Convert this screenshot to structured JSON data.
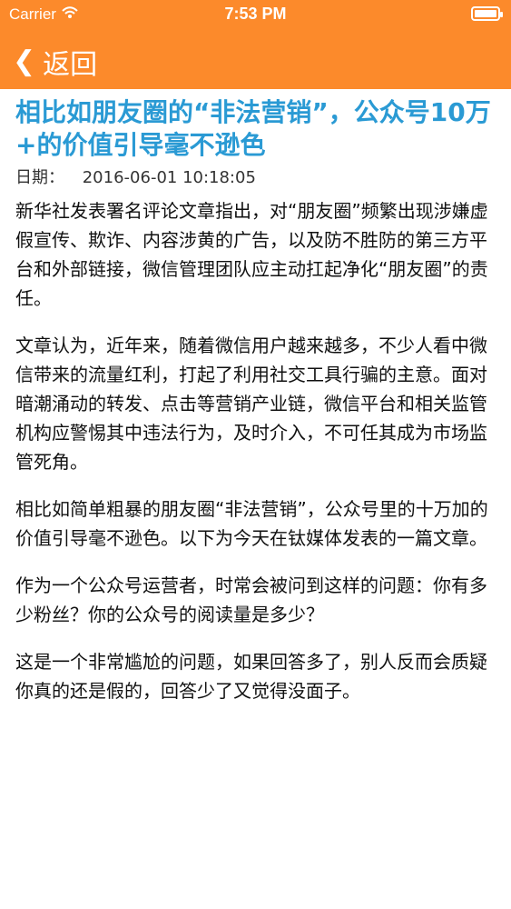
{
  "status_bar": {
    "carrier": "Carrier",
    "time": "7:53 PM",
    "wifi_icon": "wifi-icon",
    "battery_icon": "battery-icon"
  },
  "nav": {
    "back_icon": "chevron-left-icon",
    "back_label": "返回"
  },
  "article": {
    "title": "相比如朋友圈的“非法营销”，公众号10万+的价值引导毫不逊色",
    "date_label": "日期：",
    "date_value": "2016-06-01 10:18:05",
    "paragraphs": [
      "新华社发表署名评论文章指出，对“朋友圈”频繁出现涉嫌虚假宣传、欺诈、内容涉黄的广告，以及防不胜防的第三方平台和外部链接，微信管理团队应主动扛起净化“朋友圈”的责任。",
      "文章认为，近年来，随着微信用户越来越多，不少人看中微信带来的流量红利，打起了利用社交工具行骗的主意。面对暗潮涌动的转发、点击等营销产业链，微信平台和相关监管机构应警惕其中违法行为，及时介入，不可任其成为市场监管死角。",
      "相比如简单粗暴的朋友圈“非法营销”，公众号里的十万加的价值引导毫不逊色。以下为今天在钛媒体发表的一篇文章。",
      "作为一个公众号运营者，时常会被问到这样的问题：你有多少粉丝？你的公众号的阅读量是多少？",
      "这是一个非常尴尬的问题，如果回答多了，别人反而会质疑你真的还是假的，回答少了又觉得没面子。"
    ]
  },
  "colors": {
    "nav_bg": "#fc8a2b",
    "title_color": "#2a9ad4"
  }
}
